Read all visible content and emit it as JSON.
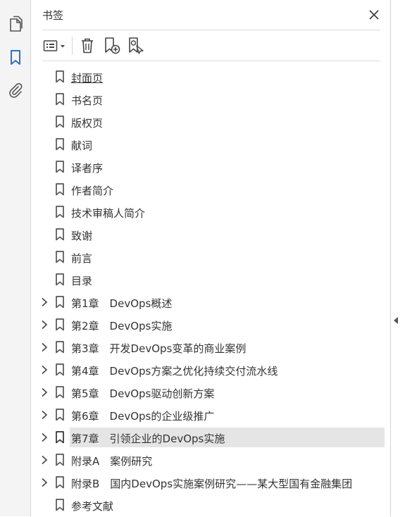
{
  "panel": {
    "title": "书签"
  },
  "left_rail": {
    "items": [
      {
        "icon": "page-thumbnails-icon"
      },
      {
        "icon": "bookmark-icon",
        "active": true
      },
      {
        "icon": "paperclip-icon"
      }
    ]
  },
  "toolbar": {
    "items": [
      {
        "icon": "options-menu-icon"
      },
      {
        "icon": "trash-icon"
      },
      {
        "icon": "add-bookmark-icon"
      },
      {
        "icon": "find-bookmark-icon"
      }
    ]
  },
  "colors": {
    "accent": "#2b6fd6",
    "selected_row": "#e5e5e5",
    "text": "#333333",
    "icon": "#555555"
  },
  "bookmarks": [
    {
      "label": "封面页",
      "expandable": false
    },
    {
      "label": "书名页",
      "expandable": false
    },
    {
      "label": "版权页",
      "expandable": false
    },
    {
      "label": "献词",
      "expandable": false
    },
    {
      "label": "译者序",
      "expandable": false
    },
    {
      "label": "作者简介",
      "expandable": false
    },
    {
      "label": "技术审稿人简介",
      "expandable": false
    },
    {
      "label": "致谢",
      "expandable": false
    },
    {
      "label": "前言",
      "expandable": false
    },
    {
      "label": "目录",
      "expandable": false
    },
    {
      "label": "第1章　DevOps概述",
      "expandable": true
    },
    {
      "label": "第2章　DevOps实施",
      "expandable": true
    },
    {
      "label": "第3章　开发DevOps变革的商业案例",
      "expandable": true
    },
    {
      "label": "第4章　DevOps方案之优化持续交付流水线",
      "expandable": true
    },
    {
      "label": "第5章　DevOps驱动创新方案",
      "expandable": true
    },
    {
      "label": "第6章　DevOps的企业级推广",
      "expandable": true
    },
    {
      "label": "第7章　引领企业的DevOps实施",
      "expandable": true,
      "selected": true
    },
    {
      "label": "附录A　案例研究",
      "expandable": true
    },
    {
      "label": "附录B　国内DevOps实施案例研究——某大型国有金融集团",
      "expandable": true
    },
    {
      "label": "参考文献",
      "expandable": false
    }
  ]
}
